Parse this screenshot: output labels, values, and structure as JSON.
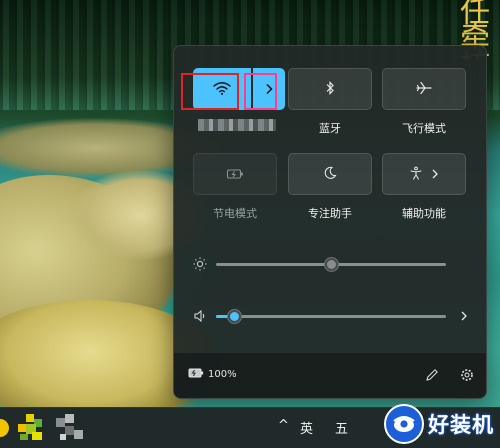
{
  "wallpaper": {
    "text": "任牵坊"
  },
  "quick_settings": {
    "tiles": [
      {
        "id": "wifi",
        "label": "",
        "state": "on",
        "icon": "wifi-icon"
      },
      {
        "id": "bluetooth",
        "label": "蓝牙",
        "state": "off",
        "icon": "bluetooth-icon"
      },
      {
        "id": "airplane",
        "label": "飞行模式",
        "state": "off",
        "icon": "airplane-icon"
      },
      {
        "id": "battery_saver",
        "label": "节电模式",
        "state": "disabled",
        "icon": "battery-saver-icon"
      },
      {
        "id": "focus_assist",
        "label": "专注助手",
        "state": "off",
        "icon": "moon-icon"
      },
      {
        "id": "accessibility",
        "label": "辅助功能",
        "state": "off",
        "icon": "accessibility-icon"
      }
    ],
    "brightness": {
      "icon": "sun-icon",
      "level": 0.5
    },
    "volume": {
      "icon": "speaker-icon",
      "level": 0.08
    },
    "battery": {
      "icon": "battery-charging-icon",
      "text": "100%"
    },
    "footer_buttons": [
      "edit-pencil-icon",
      "settings-gear-icon"
    ]
  },
  "taskbar": {
    "tray": {
      "chevron": "^",
      "lang1": "英",
      "lang2": "五"
    }
  },
  "watermark": {
    "text": "好装机"
  },
  "colors": {
    "accent": "#4cc2ff",
    "annotation_red": "#e02424",
    "annotation_pink": "#ff3d8a"
  }
}
